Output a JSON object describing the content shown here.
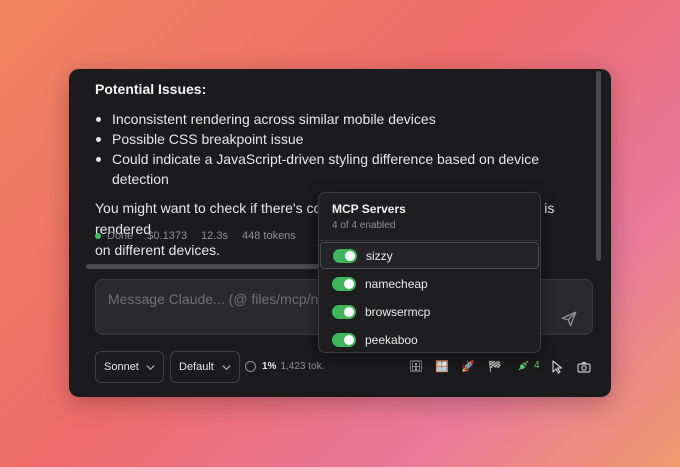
{
  "message": {
    "heading": "Potential Issues:",
    "bullets": [
      "Inconsistent rendering across similar mobile devices",
      "Possible CSS breakpoint issue",
      "Could indicate a JavaScript-driven styling difference based on device detection"
    ],
    "paragraph_line1": "You might want to check if there's conditional logic affecting how \"today\" is rendered",
    "paragraph_line2": "on different devices."
  },
  "meta": {
    "status": "Done",
    "cost": "$0.1373",
    "duration": "12.3s",
    "tokens": "448 tokens"
  },
  "input": {
    "placeholder": "Message Claude... (@ files/mcp/n"
  },
  "toolbar": {
    "model": "Sonnet",
    "mode": "Default",
    "context_pct": "1%",
    "context_tokens": "1,423 tok.",
    "mcp_count": "4",
    "icons": [
      "cabinet-icon",
      "window-icon",
      "rocket-icon",
      "flag-icon",
      "plug-icon",
      "cursor-icon",
      "camera-icon"
    ]
  },
  "mcp_popup": {
    "title": "MCP Servers",
    "subtitle": "4 of 4 enabled",
    "servers": [
      {
        "name": "sizzy",
        "enabled": true
      },
      {
        "name": "namecheap",
        "enabled": true
      },
      {
        "name": "browsermcp",
        "enabled": true
      },
      {
        "name": "peekaboo",
        "enabled": true
      }
    ]
  },
  "colors": {
    "accent_green": "#3fb65a",
    "panel_bg": "#1b1b1d"
  }
}
